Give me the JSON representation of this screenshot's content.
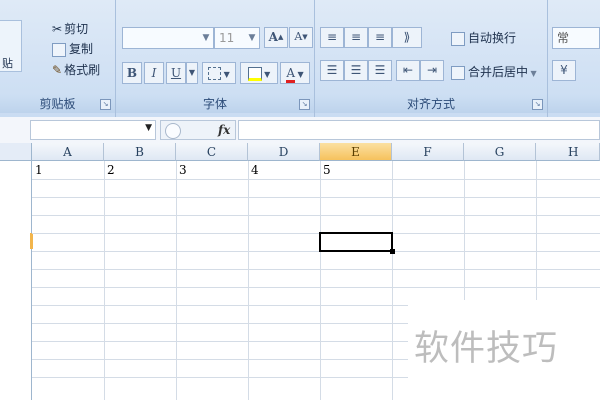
{
  "ribbon": {
    "clipboard": {
      "paste_partial": "贴",
      "cut": "剪切",
      "copy": "复制",
      "format_painter": "格式刷",
      "group_label": "剪贴板"
    },
    "font": {
      "font_name": "",
      "font_size": "11",
      "grow_font": "A",
      "shrink_font": "A",
      "bold": "B",
      "italic": "I",
      "underline": "U",
      "font_color_glyph": "A",
      "group_label": "字体"
    },
    "alignment": {
      "wrap_text": "自动换行",
      "merge_center": "合并后居中",
      "group_label": "对齐方式"
    },
    "number": {
      "format_partial": "常"
    }
  },
  "formula_bar": {
    "name_box": "",
    "fx_label": "fx",
    "formula": ""
  },
  "sheet": {
    "columns": [
      "A",
      "B",
      "C",
      "D",
      "E",
      "F",
      "G",
      "H"
    ],
    "selected_column": "E",
    "cells_row1": [
      "1",
      "2",
      "3",
      "4",
      "5"
    ]
  },
  "watermark": "软件技巧",
  "colors": {
    "ribbon_bg": "#c9dcf2",
    "selected_header": "#f6c25d",
    "gridline": "#d4dce6"
  }
}
